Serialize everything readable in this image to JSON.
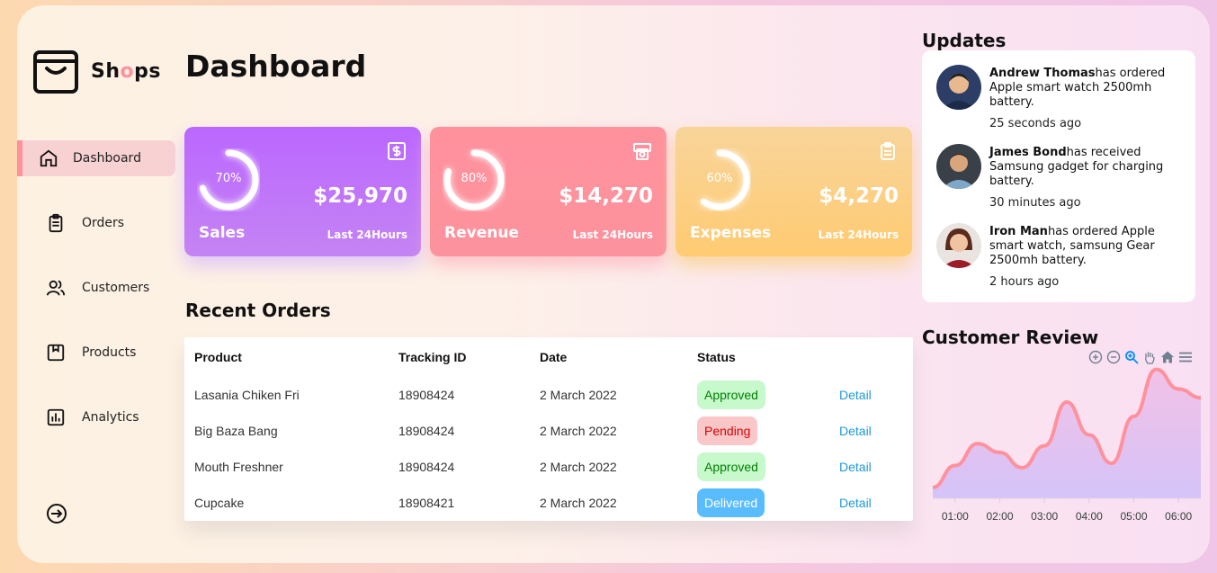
{
  "brand": {
    "prefix": "Sh",
    "accent": "o",
    "suffix": "ps"
  },
  "sidebar": {
    "items": [
      {
        "label": "Dashboard",
        "icon": "home-icon"
      },
      {
        "label": "Orders",
        "icon": "clipboard-icon"
      },
      {
        "label": "Customers",
        "icon": "users-icon"
      },
      {
        "label": "Products",
        "icon": "package-icon"
      },
      {
        "label": "Analytics",
        "icon": "bar-chart-icon"
      }
    ],
    "logout_icon": "sign-out-icon"
  },
  "main": {
    "title": "Dashboard",
    "cards": [
      {
        "name": "Sales",
        "percent_label": "70%",
        "percent": 0.7,
        "value": "$25,970",
        "period": "Last 24Hours",
        "icon": "dollar-icon"
      },
      {
        "name": "Revenue",
        "percent_label": "80%",
        "percent": 0.8,
        "value": "$14,270",
        "period": "Last 24Hours",
        "icon": "money-icon"
      },
      {
        "name": "Expenses",
        "percent_label": "60%",
        "percent": 0.6,
        "value": "$4,270",
        "period": "Last 24Hours",
        "icon": "clipboard-icon"
      }
    ],
    "recent_orders": {
      "title": "Recent Orders",
      "headers": [
        "Product",
        "Tracking ID",
        "Date",
        "Status"
      ],
      "rows": [
        {
          "product": "Lasania Chiken Fri",
          "tracking": "18908424",
          "date": "2 March 2022",
          "status": "Approved",
          "link": "Detail"
        },
        {
          "product": "Big Baza Bang",
          "tracking": "18908424",
          "date": "2 March 2022",
          "status": "Pending",
          "link": "Detail"
        },
        {
          "product": "Mouth Freshner",
          "tracking": "18908424",
          "date": "2 March 2022",
          "status": "Approved",
          "link": "Detail"
        },
        {
          "product": "Cupcake",
          "tracking": "18908421",
          "date": "2 March 2022",
          "status": "Delivered",
          "link": "Detail"
        }
      ]
    }
  },
  "updates": {
    "title": "Updates",
    "items": [
      {
        "name": "Andrew Thomas",
        "text": "has ordered Apple smart watch 2500mh battery.",
        "time": "25 seconds ago"
      },
      {
        "name": "James Bond",
        "text": "has received Samsung gadget for charging battery.",
        "time": "30 minutes ago"
      },
      {
        "name": "Iron Man",
        "text": "has ordered Apple smart watch, samsung Gear 2500mh battery.",
        "time": "2 hours ago"
      }
    ]
  },
  "review": {
    "title": "Customer Review",
    "toolbar": [
      "zoom-in-icon",
      "zoom-out-icon",
      "selection-zoom-icon",
      "pan-hand-icon",
      "home-reset-icon",
      "menu-icon"
    ]
  },
  "chart_data": {
    "type": "area",
    "title": "Customer Review",
    "x": [
      "00:30",
      "01:00",
      "01:30",
      "02:00",
      "02:30",
      "03:00",
      "03:30",
      "04:00",
      "04:30",
      "05:00",
      "05:30",
      "06:00",
      "06:15"
    ],
    "tick_labels": [
      "01:00",
      "02:00",
      "03:00",
      "04:00",
      "05:00",
      "06:00"
    ],
    "values": [
      10,
      30,
      50,
      42,
      28,
      48,
      88,
      58,
      32,
      75,
      118,
      100,
      92
    ],
    "ylim": [
      0,
      130
    ],
    "grid": false,
    "colors": {
      "line": "#ff919d",
      "fill_top": "#f3c1e6",
      "fill_bottom": "#d5c3f8"
    }
  }
}
